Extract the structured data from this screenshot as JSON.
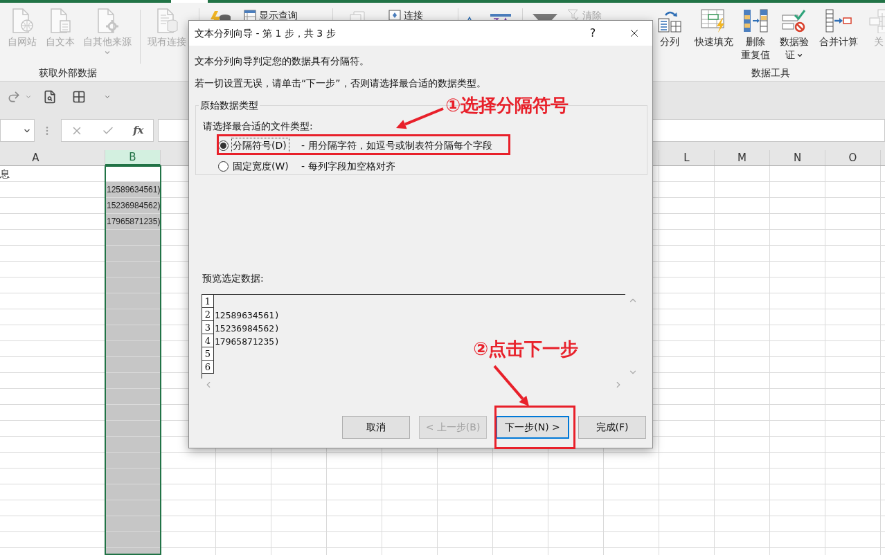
{
  "ribbon": {
    "external_data_group": {
      "label": "获取外部数据",
      "buttons": [
        {
          "lines": [
            "自网站"
          ],
          "disabled": true
        },
        {
          "lines": [
            "自文本"
          ],
          "disabled": true
        },
        {
          "lines": [
            "自其他来源"
          ],
          "disabled": true,
          "has_menu": true
        },
        {
          "lines": [
            "现有连接"
          ],
          "disabled": true
        }
      ]
    },
    "query_items": [
      {
        "label": "显示查询",
        "disabled": false
      },
      {
        "label": "连接",
        "disabled": false
      },
      {
        "label": "清除",
        "disabled": true
      }
    ],
    "data_tools_group": {
      "label": "数据工具",
      "buttons": [
        {
          "lines": [
            "分列"
          ],
          "disabled": false
        },
        {
          "lines": [
            "快速填充"
          ],
          "disabled": false
        },
        {
          "lines": [
            "删除",
            "重复值"
          ],
          "disabled": false
        },
        {
          "lines": [
            "数据验",
            "证"
          ],
          "disabled": false,
          "has_menu": true
        },
        {
          "lines": [
            "合并计算"
          ],
          "disabled": false
        },
        {
          "lines": [
            "关"
          ],
          "disabled": true
        }
      ]
    }
  },
  "formula_bar": {
    "function_button": "fx"
  },
  "sheet": {
    "columns_left": [
      {
        "label": "A",
        "selected": false
      },
      {
        "label": "B",
        "selected": true
      }
    ],
    "columns_right": [
      {
        "label": "L",
        "selected": false
      },
      {
        "label": "M",
        "selected": false
      },
      {
        "label": "N",
        "selected": false
      },
      {
        "label": "O",
        "selected": false
      }
    ],
    "rows": [
      {
        "a": "息"
      },
      {
        "b": "12589634561)"
      },
      {
        "b": "15236984562)"
      },
      {
        "b": "17965871235)"
      }
    ]
  },
  "dialog": {
    "title": "文本分列向导 - 第 1 步，共 3 步",
    "help": "?",
    "intro": "文本分列向导判定您的数据具有分隔符。",
    "instruction": "若一切设置无误，请单击“下一步”，否则请选择最合适的数据类型。",
    "group_label": "原始数据类型",
    "prompt": "请选择最合适的文件类型:",
    "options": [
      {
        "label": "分隔符号(D)",
        "description": "- 用分隔字符，如逗号或制表符分隔每个字段",
        "selected": true
      },
      {
        "label": "固定宽度(W)",
        "description": "- 每列字段加空格对齐",
        "selected": false
      }
    ],
    "preview": {
      "label": "预览选定数据:",
      "rows": [
        {
          "number": "1"
        },
        {
          "number": "2",
          "text": "12589634561)"
        },
        {
          "number": "3",
          "text": "15236984562)"
        },
        {
          "number": "4",
          "text": "17965871235)"
        },
        {
          "number": "5"
        },
        {
          "number": "6"
        }
      ]
    },
    "buttons": [
      {
        "label": "取消",
        "disabled": false,
        "focused": false
      },
      {
        "label": "< 上一步(B)",
        "disabled": true,
        "focused": false
      },
      {
        "label": "下一步(N) >",
        "disabled": false,
        "focused": true
      },
      {
        "label": "完成(F)",
        "disabled": false,
        "focused": false
      }
    ]
  },
  "annotations": [
    {
      "kind": "label",
      "text": "①选择分隔符号"
    },
    {
      "kind": "arrow"
    },
    {
      "kind": "box"
    },
    {
      "kind": "label",
      "text": "②点击下一步"
    },
    {
      "kind": "arrow"
    },
    {
      "kind": "box"
    }
  ]
}
